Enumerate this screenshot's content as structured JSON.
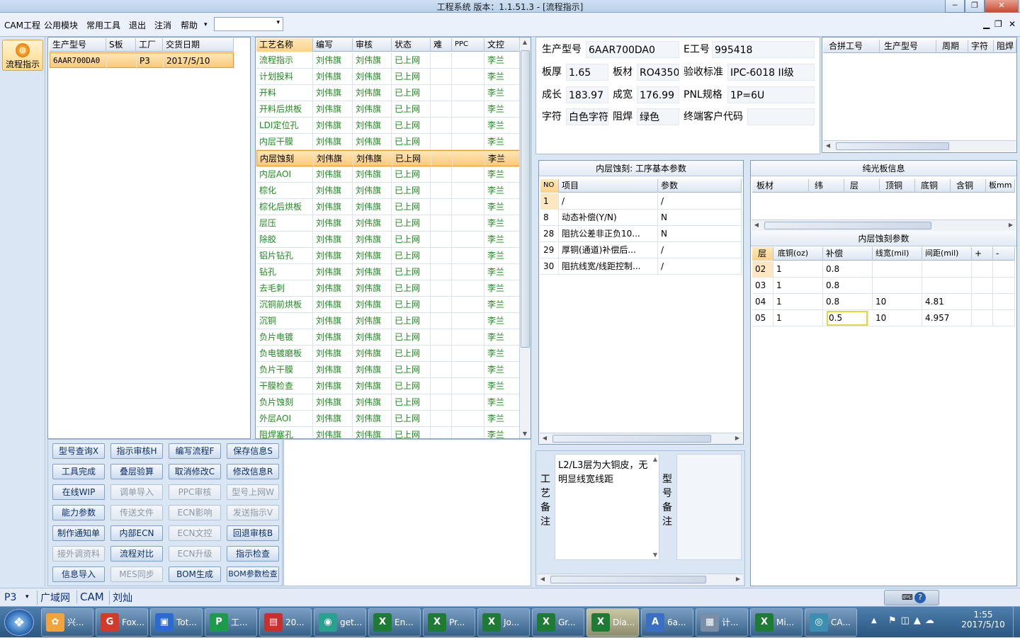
{
  "window": {
    "title": "工程系统   版本：1.1.51.3 - [流程指示]",
    "min": "─",
    "max": "❐",
    "close": "✕"
  },
  "menu": {
    "items": [
      "CAM工程",
      "公用模块",
      "常用工具",
      "退出",
      "注消",
      "帮助"
    ],
    "help_arrow": "▾",
    "combo_arrow": "▾",
    "mdi_min": "▁",
    "mdi_max": "❐",
    "mdi_close": "✕"
  },
  "leftbar": {
    "flow_label": "流程指示"
  },
  "orders": {
    "headers": [
      "生产型号",
      "S板",
      "工厂",
      "交货日期"
    ],
    "rows": [
      {
        "model": "6AAR700DA0",
        "s": "",
        "factory": "P3",
        "date": "2017/5/10"
      }
    ]
  },
  "process": {
    "headers": [
      "工艺名称",
      "编写",
      "审核",
      "状态",
      "难",
      "PPC",
      "文控"
    ],
    "rows": [
      {
        "name": "流程指示",
        "writer": "刘伟旗",
        "auditor": "刘伟旗",
        "status": "已上网",
        "doc": "李兰"
      },
      {
        "name": "计划投料",
        "writer": "刘伟旗",
        "auditor": "刘伟旗",
        "status": "已上网",
        "doc": "李兰"
      },
      {
        "name": "开料",
        "writer": "刘伟旗",
        "auditor": "刘伟旗",
        "status": "已上网",
        "doc": "李兰"
      },
      {
        "name": "开料后烘板",
        "writer": "刘伟旗",
        "auditor": "刘伟旗",
        "status": "已上网",
        "doc": "李兰"
      },
      {
        "name": "LDI定位孔",
        "writer": "刘伟旗",
        "auditor": "刘伟旗",
        "status": "已上网",
        "doc": "李兰"
      },
      {
        "name": "内层干膜",
        "writer": "刘伟旗",
        "auditor": "刘伟旗",
        "status": "已上网",
        "doc": "李兰"
      },
      {
        "name": "内层蚀刻",
        "writer": "刘伟旗",
        "auditor": "刘伟旗",
        "status": "已上网",
        "doc": "李兰"
      },
      {
        "name": "内层AOI",
        "writer": "刘伟旗",
        "auditor": "刘伟旗",
        "status": "已上网",
        "doc": "李兰"
      },
      {
        "name": "棕化",
        "writer": "刘伟旗",
        "auditor": "刘伟旗",
        "status": "已上网",
        "doc": "李兰"
      },
      {
        "name": "棕化后烘板",
        "writer": "刘伟旗",
        "auditor": "刘伟旗",
        "status": "已上网",
        "doc": "李兰"
      },
      {
        "name": "层压",
        "writer": "刘伟旗",
        "auditor": "刘伟旗",
        "status": "已上网",
        "doc": "李兰"
      },
      {
        "name": "除胶",
        "writer": "刘伟旗",
        "auditor": "刘伟旗",
        "status": "已上网",
        "doc": "李兰"
      },
      {
        "name": "铝片钻孔",
        "writer": "刘伟旗",
        "auditor": "刘伟旗",
        "status": "已上网",
        "doc": "李兰"
      },
      {
        "name": "钻孔",
        "writer": "刘伟旗",
        "auditor": "刘伟旗",
        "status": "已上网",
        "doc": "李兰"
      },
      {
        "name": "去毛刺",
        "writer": "刘伟旗",
        "auditor": "刘伟旗",
        "status": "已上网",
        "doc": "李兰"
      },
      {
        "name": "沉铜前烘板",
        "writer": "刘伟旗",
        "auditor": "刘伟旗",
        "status": "已上网",
        "doc": "李兰"
      },
      {
        "name": "沉铜",
        "writer": "刘伟旗",
        "auditor": "刘伟旗",
        "status": "已上网",
        "doc": "李兰"
      },
      {
        "name": "负片电镀",
        "writer": "刘伟旗",
        "auditor": "刘伟旗",
        "status": "已上网",
        "doc": "李兰"
      },
      {
        "name": "负电镀磨板",
        "writer": "刘伟旗",
        "auditor": "刘伟旗",
        "status": "已上网",
        "doc": "李兰"
      },
      {
        "name": "负片干膜",
        "writer": "刘伟旗",
        "auditor": "刘伟旗",
        "status": "已上网",
        "doc": "李兰"
      },
      {
        "name": "干膜检查",
        "writer": "刘伟旗",
        "auditor": "刘伟旗",
        "status": "已上网",
        "doc": "李兰"
      },
      {
        "name": "负片蚀刻",
        "writer": "刘伟旗",
        "auditor": "刘伟旗",
        "status": "已上网",
        "doc": "李兰"
      },
      {
        "name": "外层AOI",
        "writer": "刘伟旗",
        "auditor": "刘伟旗",
        "status": "已上网",
        "doc": "李兰"
      },
      {
        "name": "阻焊塞孔",
        "writer": "刘伟旗",
        "auditor": "刘伟旗",
        "status": "已上网",
        "doc": "李兰"
      }
    ],
    "selected_index": 6
  },
  "buttons": [
    {
      "label": "型号查询X",
      "enabled": true
    },
    {
      "label": "指示审核H",
      "enabled": true
    },
    {
      "label": "编写流程F",
      "enabled": true
    },
    {
      "label": "保存信息S",
      "enabled": true
    },
    {
      "label": "工具完成",
      "enabled": true
    },
    {
      "label": "叠层验算",
      "enabled": true
    },
    {
      "label": "取消修改C",
      "enabled": true
    },
    {
      "label": "修改信息R",
      "enabled": true
    },
    {
      "label": "在线WIP",
      "enabled": true
    },
    {
      "label": "调单导入",
      "enabled": false
    },
    {
      "label": "PPC审核",
      "enabled": false
    },
    {
      "label": "型号上网W",
      "enabled": false
    },
    {
      "label": "能力参数",
      "enabled": true
    },
    {
      "label": "传送文件",
      "enabled": false
    },
    {
      "label": "ECN影响",
      "enabled": false
    },
    {
      "label": "发送指示V",
      "enabled": false
    },
    {
      "label": "制作通知单",
      "enabled": true
    },
    {
      "label": "内部ECN",
      "enabled": true
    },
    {
      "label": "ECN文控",
      "enabled": false
    },
    {
      "label": "回退审核B",
      "enabled": true
    },
    {
      "label": "接外调资料",
      "enabled": false
    },
    {
      "label": "流程对比",
      "enabled": true
    },
    {
      "label": "ECN升级",
      "enabled": false
    },
    {
      "label": "指示检查",
      "enabled": true
    },
    {
      "label": "信息导入",
      "enabled": true
    },
    {
      "label": "MES同步",
      "enabled": false
    },
    {
      "label": "BOM生成",
      "enabled": true
    },
    {
      "label": "BOM参数检查",
      "enabled": true
    }
  ],
  "info": {
    "model_label": "生产型号",
    "model": "6AAR700DA0",
    "e_label": "E工号",
    "e": "995418",
    "thick_label": "板厚",
    "thick": "1.65",
    "mat_label": "板材",
    "mat": "RO4350E",
    "std_label": "验收标准",
    "std": "IPC-6018 II级",
    "len_label": "成长",
    "len": "183.97",
    "wid_label": "成宽",
    "wid": "176.99",
    "pnl_label": "PNL规格",
    "pnl": "1P=6U",
    "char_label": "字符",
    "char": "白色字符",
    "mask_label": "阻焊",
    "mask": "绿色",
    "cust_label": "终端客户代码",
    "cust": ""
  },
  "merge": {
    "headers": [
      "合拼工号",
      "生产型号",
      "周期",
      "字符",
      "阻焊"
    ]
  },
  "params": {
    "title": "内层蚀刻: 工序基本参数",
    "headers": [
      "NO",
      "项目",
      "参数"
    ],
    "rows": [
      {
        "no": "1",
        "item": "/",
        "val": "/"
      },
      {
        "no": "8",
        "item": "动态补偿(Y/N)",
        "val": "N"
      },
      {
        "no": "28",
        "item": "阻抗公差非正负10...",
        "val": "N"
      },
      {
        "no": "29",
        "item": "厚铜(通道)补偿后...",
        "val": "/"
      },
      {
        "no": "30",
        "item": "阻抗线宽/线距控制...",
        "val": "/"
      }
    ]
  },
  "pure": {
    "title": "纯光板信息",
    "headers": [
      "板材",
      "纬",
      "层",
      "顶铜",
      "底铜",
      "含铜",
      "板mm"
    ]
  },
  "etch": {
    "title": "内层蚀刻参数",
    "headers": [
      "层",
      "底铜(oz)",
      "补偿",
      "线宽(mil)",
      "间距(mil)",
      "+",
      "-"
    ],
    "rows": [
      {
        "layer": "02",
        "cu": "1",
        "comp": "0.8",
        "lw": "",
        "sp": ""
      },
      {
        "layer": "03",
        "cu": "1",
        "comp": "0.8",
        "lw": "",
        "sp": ""
      },
      {
        "layer": "04",
        "cu": "1",
        "comp": "0.8",
        "lw": "10",
        "sp": "4.81"
      },
      {
        "layer": "05",
        "cu": "1",
        "comp": "0.5",
        "lw": "10",
        "sp": "4.957"
      }
    ]
  },
  "notes": {
    "craft_label": "工艺备注",
    "craft_text": "L2/L3层为大铜皮，无明显线宽线距",
    "model_label": "型号备注",
    "model_text": ""
  },
  "status": {
    "factory": "P3",
    "items": [
      "广域网",
      "CAM",
      "刘灿"
    ]
  },
  "taskbar": {
    "apps": [
      "兴...",
      "Fox...",
      "Tot...",
      "工...",
      "20...",
      "get...",
      "En...",
      "Pr...",
      "Jo...",
      "Gr...",
      "Dia...",
      "6a...",
      "计...",
      "Mi...",
      "CA..."
    ],
    "time": "1:55",
    "date": "2017/5/10"
  }
}
